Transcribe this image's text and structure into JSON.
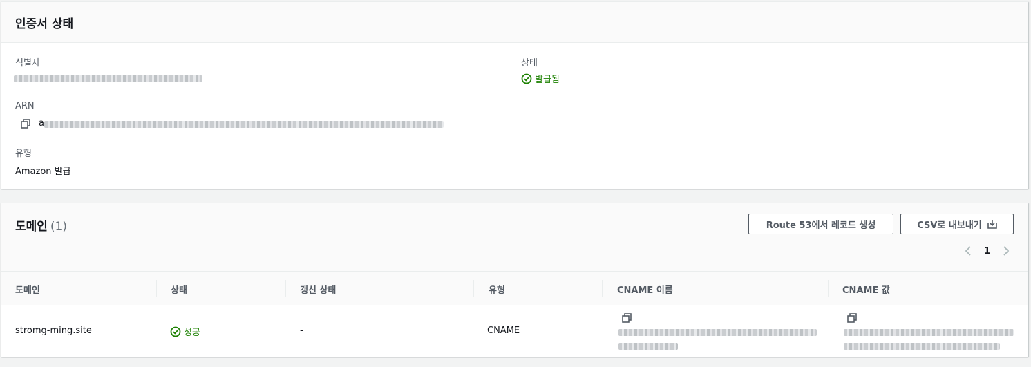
{
  "certificate_status": {
    "title": "인증서 상태",
    "identifier_label": "식별자",
    "status_label": "상태",
    "status_value": "발급됨",
    "arn_label": "ARN",
    "arn_prefix": "a",
    "type_label": "유형",
    "type_value": "Amazon 발급"
  },
  "domains": {
    "title": "도메인",
    "count": "(1)",
    "route53_button": "Route 53에서 레코드 생성",
    "csv_button": "CSV로 내보내기",
    "page_number": "1",
    "columns": [
      "도메인",
      "상태",
      "갱신 상태",
      "유형",
      "CNAME 이름",
      "CNAME 값"
    ],
    "rows": [
      {
        "domain": "stromg-ming.site",
        "status": "성공",
        "renewal_status": "-",
        "type": "CNAME"
      }
    ]
  },
  "colors": {
    "success": "#1d8102",
    "text": "#16191f",
    "label": "#545b64",
    "header_bg": "#fafafa",
    "page_bg": "#f2f3f3"
  },
  "icons": [
    "check-circle-icon",
    "copy-icon",
    "download-icon",
    "chevron-left-icon",
    "chevron-right-icon"
  ]
}
